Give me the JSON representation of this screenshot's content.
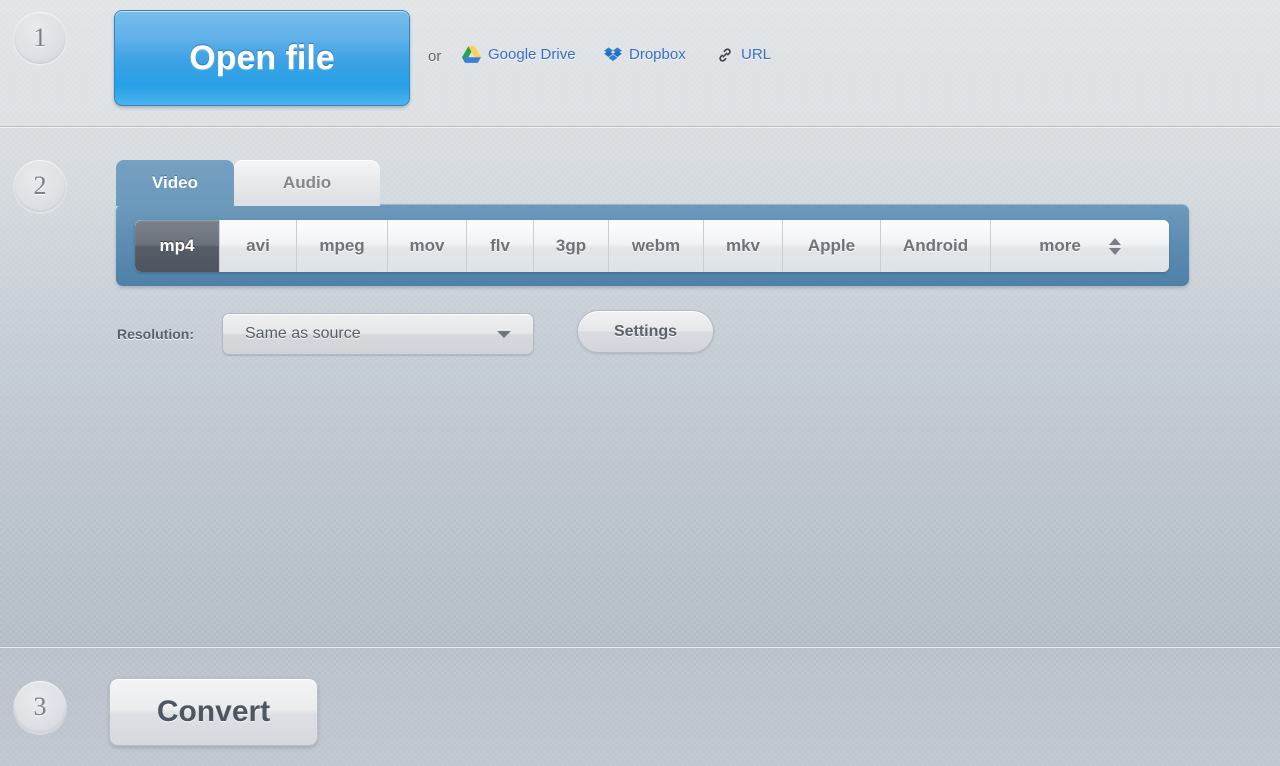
{
  "steps": {
    "one": "1",
    "two": "2",
    "three": "3"
  },
  "step1": {
    "open_file_label": "Open file",
    "or_label": "or",
    "sources": [
      {
        "label": "Google Drive",
        "icon": "google-drive-icon"
      },
      {
        "label": "Dropbox",
        "icon": "dropbox-icon"
      },
      {
        "label": "URL",
        "icon": "link-icon"
      }
    ]
  },
  "step2": {
    "tabs": [
      {
        "label": "Video",
        "active": true
      },
      {
        "label": "Audio",
        "active": false
      }
    ],
    "formats": [
      {
        "label": "mp4",
        "selected": true
      },
      {
        "label": "avi",
        "selected": false
      },
      {
        "label": "mpeg",
        "selected": false
      },
      {
        "label": "mov",
        "selected": false
      },
      {
        "label": "flv",
        "selected": false
      },
      {
        "label": "3gp",
        "selected": false
      },
      {
        "label": "webm",
        "selected": false
      },
      {
        "label": "mkv",
        "selected": false
      },
      {
        "label": "Apple",
        "selected": false
      },
      {
        "label": "Android",
        "selected": false
      },
      {
        "label": "more",
        "selected": false,
        "icon": "stepper-updown-icon"
      }
    ],
    "resolution_label": "Resolution:",
    "resolution_value": "Same as source",
    "settings_label": "Settings"
  },
  "step3": {
    "convert_label": "Convert"
  },
  "colors": {
    "accent_blue": "#3da2e4",
    "tab_blue": "#6b9abd",
    "background": "#b7bec7",
    "link_blue": "#3b6fbf",
    "selected_format": "#5a616a"
  }
}
